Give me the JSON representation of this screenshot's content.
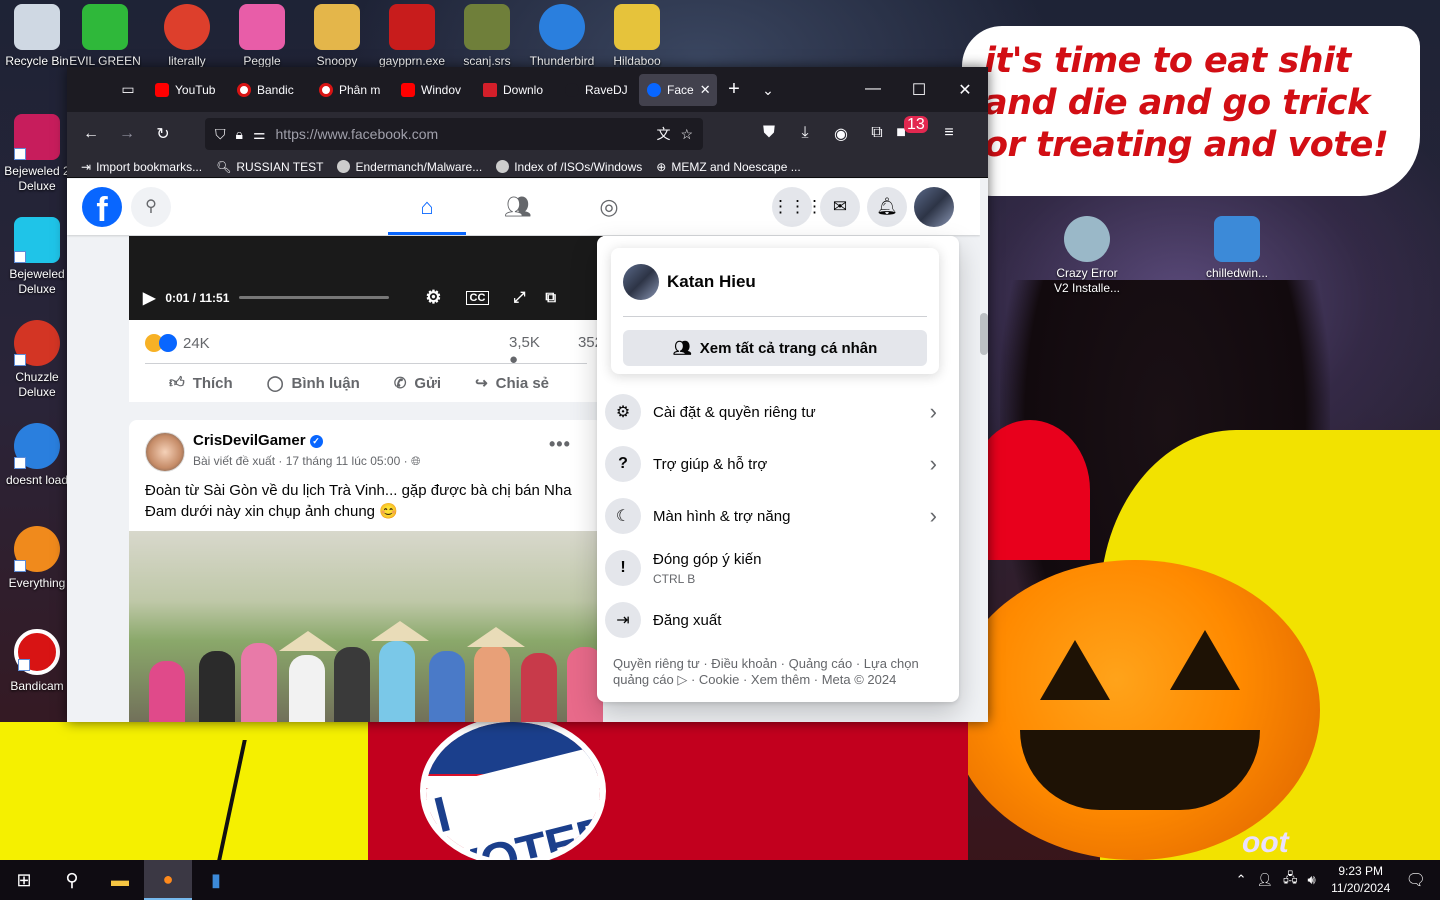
{
  "desktop": {
    "top_icons": [
      {
        "label": "Recycle Bin",
        "color": "#cfd8e3"
      },
      {
        "label": "EVIL GREEN",
        "color": "#2fb83a"
      },
      {
        "label": "literally",
        "color": "#dd3f2c"
      },
      {
        "label": "Peggle",
        "color": "#e85da8"
      },
      {
        "label": "Snoopy",
        "color": "#e4b64a"
      },
      {
        "label": "gaypprn.exe",
        "color": "#c81c1c"
      },
      {
        "label": "scanj.srs",
        "color": "#6f7f3a"
      },
      {
        "label": "Thunderbird",
        "color": "#2a7fde"
      },
      {
        "label": "Hildaboo",
        "color": "#e6c33b"
      }
    ],
    "left_icons": [
      {
        "label": "Bejeweled 2 Deluxe",
        "color": "#c71d5c"
      },
      {
        "label": "Bejeweled Deluxe",
        "color": "#1fc4e8"
      },
      {
        "label": "Chuzzle Deluxe",
        "color": "#d33524"
      },
      {
        "label": "doesnt load",
        "color": "#2a7fde"
      },
      {
        "label": "Everything",
        "color": "#f08a1c"
      },
      {
        "label": "Bandicam",
        "color": "#d81414"
      }
    ],
    "right_icons": [
      {
        "label": "Crazy Error V2 Installe...",
        "color": "#9ab8c8"
      },
      {
        "label": "chilledwin...",
        "color": "#3c8ad8"
      }
    ],
    "speech_bubble": [
      "it's time to eat shit",
      "and die and go trick",
      "or treating and vote!"
    ],
    "badge_text": "I VOTED",
    "corner_text": "oot"
  },
  "browser": {
    "tabs": [
      {
        "label": "YouTub",
        "color": "#ff0000"
      },
      {
        "label": "Bandic",
        "color": "#d81414"
      },
      {
        "label": "Phân m",
        "color": "#d81414"
      },
      {
        "label": "Windov",
        "color": "#ff0000"
      },
      {
        "label": "Downlo",
        "color": "#d31f2a"
      },
      {
        "label": "RaveDJ",
        "color": "#1c1b22"
      }
    ],
    "active_tab": {
      "label": "Face",
      "color": "#0866ff"
    },
    "url": "https://www.facebook.com",
    "extension_badge": "13",
    "bookmarks": [
      {
        "label": "Import bookmarks...",
        "icon": "import-icon"
      },
      {
        "label": "RUSSIAN TEST",
        "icon": "search-icon"
      },
      {
        "label": "Endermanch/Malware...",
        "icon": "google-icon"
      },
      {
        "label": "Index of /ISOs/Windows",
        "icon": "google-icon"
      },
      {
        "label": "MEMZ and Noescape ...",
        "icon": "globe-icon"
      }
    ]
  },
  "facebook": {
    "video": {
      "time": "0:01 / 11:51"
    },
    "post1": {
      "reactions": "24K",
      "comments": "3,5K",
      "shares": "352",
      "actions": {
        "like": "Thích",
        "comment": "Bình luận",
        "send": "Gửi",
        "share": "Chia sẻ"
      }
    },
    "post2": {
      "author": "CrisDevilGamer",
      "meta": "Bài viết đề xuất · 17 tháng 11 lúc 05:00 ·",
      "text": "Đoàn từ Sài Gòn về du lịch Trà Vinh... gặp được bà chị bán Nha Đam dưới này xin chụp ảnh chung 😊"
    },
    "menu": {
      "profile_name": "Katan Hieu",
      "see_profiles": "Xem tất cả trang cá nhân",
      "items": [
        {
          "label": "Cài đặt & quyền riêng tư",
          "icon": "gear-icon",
          "glyph": "⚙",
          "sub": ""
        },
        {
          "label": "Trợ giúp & hỗ trợ",
          "icon": "help-icon",
          "glyph": "?",
          "sub": ""
        },
        {
          "label": "Màn hình & trợ năng",
          "icon": "moon-icon",
          "glyph": "☾",
          "sub": ""
        },
        {
          "label": "Đóng góp ý kiến",
          "icon": "feedback-icon",
          "glyph": "!",
          "sub": "CTRL B"
        },
        {
          "label": "Đăng xuất",
          "icon": "logout-icon",
          "glyph": "⇥",
          "sub": ""
        }
      ],
      "footer": "Quyền riêng tư · Điều khoản · Quảng cáo · Lựa chọn quảng cáo ▷ · Cookie · Xem thêm · Meta © 2024"
    }
  },
  "taskbar": {
    "time": "9:23 PM",
    "date": "11/20/2024"
  }
}
